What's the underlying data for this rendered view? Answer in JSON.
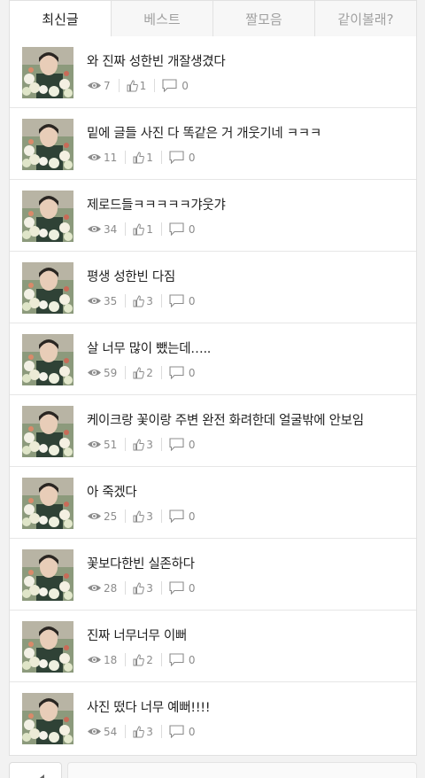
{
  "tabs": [
    {
      "label": "최신글",
      "active": true
    },
    {
      "label": "베스트",
      "active": false
    },
    {
      "label": "짤모음",
      "active": false
    },
    {
      "label": "같이볼래?",
      "active": false
    }
  ],
  "posts": [
    {
      "title": "와 진짜 성한빈 개잘생겼다",
      "views": "7",
      "likes": "1",
      "comments": "0"
    },
    {
      "title": "밑에 글들 사진 다 똑같은 거 개웃기네 ㅋㅋㅋ",
      "views": "11",
      "likes": "1",
      "comments": "0"
    },
    {
      "title": "제로드들ㅋㅋㅋㅋㅋ갸웃갸",
      "views": "34",
      "likes": "1",
      "comments": "0"
    },
    {
      "title": "평생 성한빈 다짐",
      "views": "35",
      "likes": "3",
      "comments": "0"
    },
    {
      "title": "살 너무 많이 뺐는데…..",
      "views": "59",
      "likes": "2",
      "comments": "0"
    },
    {
      "title": "케이크랑 꽃이랑 주변 완전 화려한데 얼굴밖에 안보임",
      "views": "51",
      "likes": "3",
      "comments": "0"
    },
    {
      "title": "아 죽겠다",
      "views": "25",
      "likes": "3",
      "comments": "0"
    },
    {
      "title": "꽃보다한빈 실존하다",
      "views": "28",
      "likes": "3",
      "comments": "0"
    },
    {
      "title": "진짜 너무너무 이뻐",
      "views": "18",
      "likes": "2",
      "comments": "0"
    },
    {
      "title": "사진 떴다 너무 예뻐!!!!",
      "views": "54",
      "likes": "3",
      "comments": "0"
    }
  ],
  "icons": {
    "views": "eye-icon",
    "likes": "thumbs-up-icon",
    "comments": "comment-icon",
    "pager": "chevron-left-icon"
  },
  "colors": {
    "meta_text": "#8c8c8c",
    "title_text": "#222222",
    "active_tab_text": "#222222",
    "inactive_tab_text": "#a0a0a0"
  }
}
